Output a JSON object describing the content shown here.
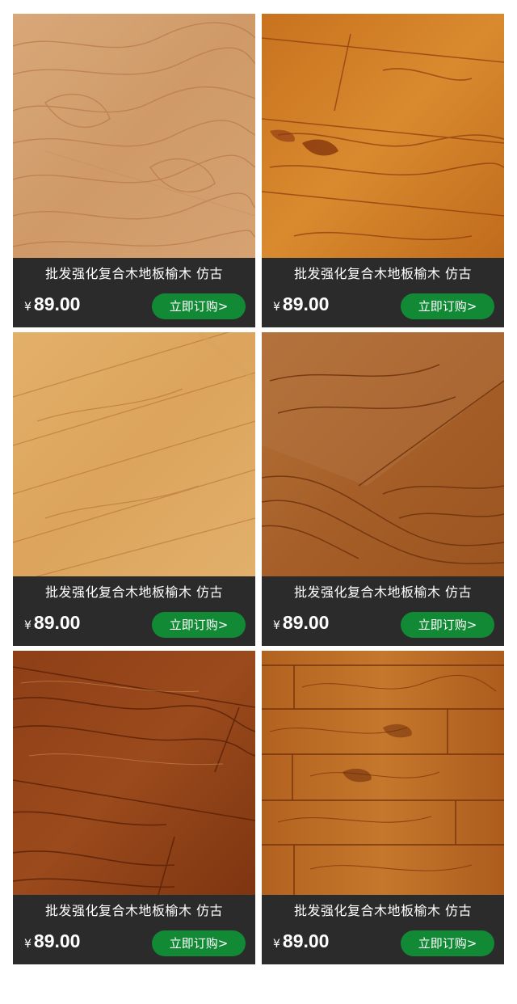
{
  "products": [
    {
      "title": "批发强化复合木地板榆木 仿古",
      "currency": "¥",
      "price": "89.00",
      "button": "立即订购>",
      "wood": "light-oak"
    },
    {
      "title": "批发强化复合木地板榆木 仿古",
      "currency": "¥",
      "price": "89.00",
      "button": "立即订购>",
      "wood": "amber-elm"
    },
    {
      "title": "批发强化复合木地板榆木 仿古",
      "currency": "¥",
      "price": "89.00",
      "button": "立即订购>",
      "wood": "pale-oak"
    },
    {
      "title": "批发强化复合木地板榆木 仿古",
      "currency": "¥",
      "price": "89.00",
      "button": "立即订购>",
      "wood": "brown-oak"
    },
    {
      "title": "批发强化复合木地板榆木 仿古",
      "currency": "¥",
      "price": "89.00",
      "button": "立即订购>",
      "wood": "dark-red-oak"
    },
    {
      "title": "批发强化复合木地板榆木 仿古",
      "currency": "¥",
      "price": "89.00",
      "button": "立即订购>",
      "wood": "rustic-elm-planks"
    }
  ],
  "colors": {
    "card_background": "#2b2b2b",
    "button_green": "#128a35",
    "text": "#ffffff"
  }
}
